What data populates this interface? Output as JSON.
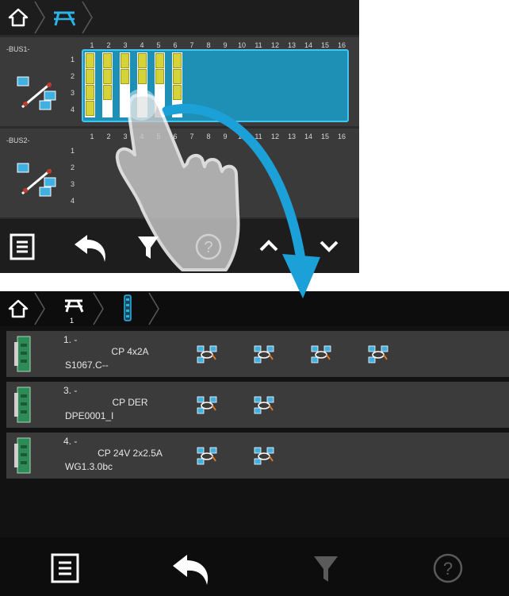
{
  "top_screen": {
    "breadcrumb": [
      "home-icon",
      "bus-topology-icon"
    ],
    "buses": [
      {
        "label": "-BUS1-",
        "columns": [
          "1",
          "2",
          "3",
          "4",
          "5",
          "6",
          "7",
          "8",
          "9",
          "10",
          "11",
          "12",
          "13",
          "14",
          "15",
          "16"
        ],
        "rows": [
          "1",
          "2",
          "3",
          "4"
        ]
      },
      {
        "label": "-BUS2-",
        "columns": [
          "1",
          "2",
          "3",
          "4",
          "5",
          "6",
          "7",
          "8",
          "9",
          "10",
          "11",
          "12",
          "13",
          "14",
          "15",
          "16"
        ],
        "rows": [
          "1",
          "2",
          "3",
          "4"
        ]
      }
    ],
    "toolbar": [
      "menu-icon",
      "back-icon",
      "filter-icon",
      "help-icon",
      "up-icon",
      "down-icon"
    ]
  },
  "bottom_screen": {
    "breadcrumb": {
      "level1_index": "1"
    },
    "devices": [
      {
        "index": "1. -",
        "name": "CP 4x2A",
        "id": "S1067.C--",
        "links": 4
      },
      {
        "index": "3. -",
        "name": "CP DER",
        "id": "DPE0001_I",
        "links": 2
      },
      {
        "index": "4. -",
        "name": "CP 24V 2x2.5A",
        "id": "WG1.3.0bc",
        "links": 2
      }
    ],
    "toolbar": [
      "menu-icon",
      "back-icon",
      "filter-icon",
      "help-icon"
    ]
  },
  "colors": {
    "accent": "#1e8fb5",
    "accent_light": "#42c5f0",
    "module": "#d6d23a",
    "device_green": "#2e8b57"
  }
}
